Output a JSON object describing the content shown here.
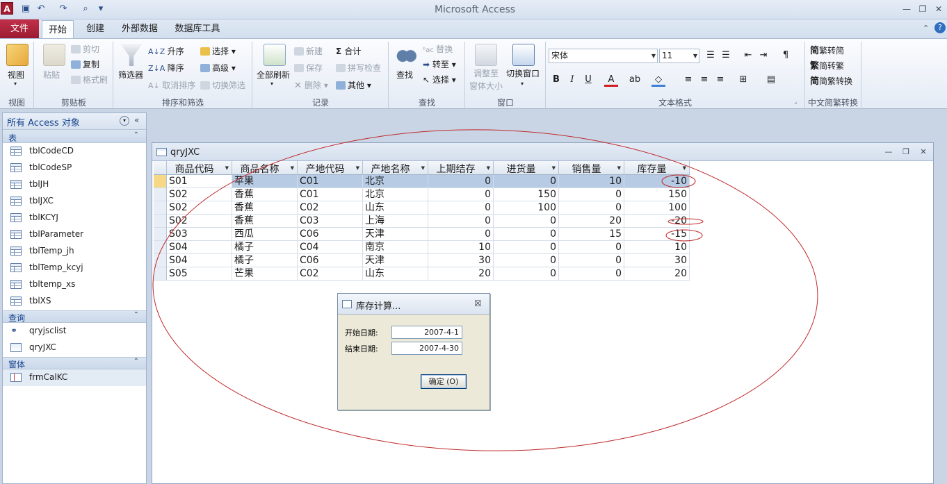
{
  "titlebar": {
    "title": "Microsoft Access",
    "app_icon_letter": "A"
  },
  "tabs": {
    "file": "文件",
    "home": "开始",
    "create": "创建",
    "external": "外部数据",
    "dbtools": "数据库工具"
  },
  "ribbon": {
    "view": {
      "label": "视图",
      "group": "视图"
    },
    "clipboard": {
      "paste": "粘贴",
      "cut": "剪切",
      "copy": "复制",
      "format_painter": "格式刷",
      "group": "剪贴板"
    },
    "sort": {
      "filter": "筛选器",
      "asc": "升序",
      "desc": "降序",
      "clear_sort": "取消排序",
      "selection": "选择",
      "advanced": "高级",
      "toggle_filter": "切换筛选",
      "group": "排序和筛选"
    },
    "records": {
      "refresh_all": "全部刷新",
      "new": "新建",
      "save": "保存",
      "delete": "删除",
      "totals": "合计",
      "spelling": "拼写检查",
      "more": "其他",
      "group": "记录"
    },
    "find": {
      "find": "查找",
      "replace": "替换",
      "goto": "转至",
      "select": "选择",
      "group": "查找"
    },
    "window": {
      "fit": "调整至",
      "fit2": "窗体大小",
      "switch": "切换窗口",
      "group": "窗口"
    },
    "text": {
      "font": "宋体",
      "size": "11",
      "bold": "B",
      "italic": "I",
      "underline": "U",
      "group": "文本格式"
    },
    "chinese": {
      "t2s": "繁转简",
      "s2t": "简转繁",
      "conv": "简繁转换",
      "group": "中文简繁转换"
    }
  },
  "nav": {
    "title": "所有 Access 对象",
    "sections": [
      {
        "label": "表",
        "items": [
          "tblCodeCD",
          "tblCodeSP",
          "tblJH",
          "tblJXC",
          "tblKCYJ",
          "tblParameter",
          "tblTemp_jh",
          "tblTemp_kcyj",
          "tbltemp_xs",
          "tblXS"
        ]
      },
      {
        "label": "查询",
        "items": [
          "qryjsclist",
          "qryJXC"
        ]
      },
      {
        "label": "窗体",
        "items": [
          "frmCalKC"
        ]
      }
    ]
  },
  "query": {
    "title": "qryJXC",
    "columns": [
      "商品代码",
      "商品名称",
      "产地代码",
      "产地名称",
      "上期结存",
      "进货量",
      "销售量",
      "库存量"
    ],
    "rows": [
      [
        "S01",
        "苹果",
        "C01",
        "北京",
        "0",
        "0",
        "10",
        "-10"
      ],
      [
        "S02",
        "香蕉",
        "C01",
        "北京",
        "0",
        "150",
        "0",
        "150"
      ],
      [
        "S02",
        "香蕉",
        "C02",
        "山东",
        "0",
        "100",
        "0",
        "100"
      ],
      [
        "S02",
        "香蕉",
        "C03",
        "上海",
        "0",
        "0",
        "20",
        "-20"
      ],
      [
        "S03",
        "西瓜",
        "C06",
        "天津",
        "0",
        "0",
        "15",
        "-15"
      ],
      [
        "S04",
        "橘子",
        "C04",
        "南京",
        "10",
        "0",
        "0",
        "10"
      ],
      [
        "S04",
        "橘子",
        "C06",
        "天津",
        "30",
        "0",
        "0",
        "30"
      ],
      [
        "S05",
        "芒果",
        "C02",
        "山东",
        "20",
        "0",
        "0",
        "20"
      ]
    ]
  },
  "dialog": {
    "title": "库存计算...",
    "start_label": "开始日期:",
    "start_value": "2007-4-1",
    "end_label": "结束日期:",
    "end_value": "2007-4-30",
    "ok": "确定 (O)"
  },
  "colors": {
    "accent": "#c2304a",
    "annotation": "#c0282a",
    "selected_row": "#b7cbe5"
  }
}
